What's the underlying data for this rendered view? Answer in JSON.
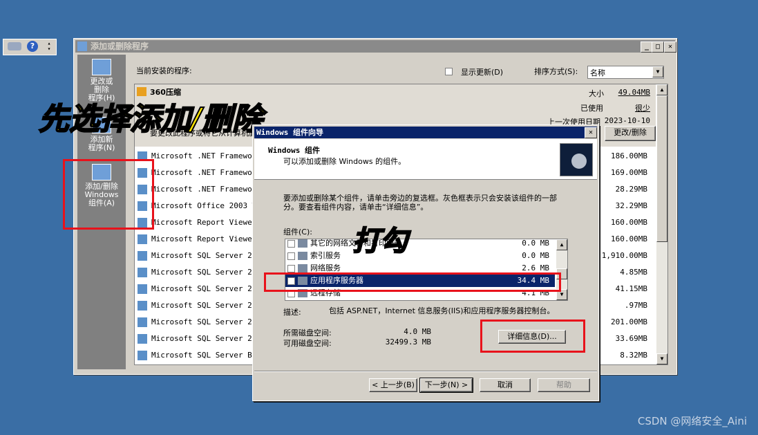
{
  "toolbar": {
    "help_label": "?"
  },
  "window": {
    "title": "添加或删除程序",
    "minimize": "_",
    "maximize": "□",
    "close": "✕",
    "installed_label": "当前安装的程序:",
    "show_updates_label": "显示更新(D)",
    "sort_label": "排序方式(S):",
    "sort_value": "名称"
  },
  "sidebar": {
    "items": [
      {
        "label": "更改或\n删除\n程序(H)"
      },
      {
        "label": "添加新\n程序(N)"
      },
      {
        "label": "添加/删除\nWindows\n组件(A)"
      }
    ]
  },
  "selected_program": {
    "name": "360压缩",
    "desc": "要更改此程序或将它从计算机删除",
    "size_label": "大小",
    "size_value": "49.04MB",
    "used_label": "已使用",
    "used_value": "很少",
    "last_used_label": "上一次使用日期",
    "last_used_value": "2023-10-10",
    "change_remove_button": "更改/删除"
  },
  "programs": [
    {
      "name": "Microsoft .NET Framework",
      "size_label": "小",
      "size": "186.00MB"
    },
    {
      "name": "Microsoft .NET Framework",
      "size_label": "小",
      "size": "169.00MB"
    },
    {
      "name": "Microsoft .NET Framework",
      "size_label": "小",
      "size": "28.29MB"
    },
    {
      "name": "Microsoft Office 2003 Web",
      "size_label": "小",
      "size": "32.29MB"
    },
    {
      "name": "Microsoft Report Viewer R",
      "size_label": "小",
      "size": "160.00MB"
    },
    {
      "name": "Microsoft Report Viewer R",
      "size_label": "小",
      "size": "160.00MB"
    },
    {
      "name": "Microsoft SQL Server 2008",
      "size_label": "小",
      "size": "1,910.00MB"
    },
    {
      "name": "Microsoft SQL Server 2008",
      "size_label": "小",
      "size": "4.85MB"
    },
    {
      "name": "Microsoft SQL Server 2008",
      "size_label": "小",
      "size": "41.15MB"
    },
    {
      "name": "Microsoft SQL Server 2008",
      "size_label": "小",
      "size": ".97MB"
    },
    {
      "name": "Microsoft SQL Server 2008",
      "size_label": "小",
      "size": "201.00MB"
    },
    {
      "name": "Microsoft SQL Server 2008",
      "size_label": "小",
      "size": "33.69MB"
    },
    {
      "name": "Microsoft SQL Server Brow",
      "size_label": "小",
      "size": "8.32MB"
    }
  ],
  "dialog": {
    "title": "Windows 组件向导",
    "close": "✕",
    "heading": "Windows 组件",
    "subheading": "可以添加或删除 Windows 的组件。",
    "instructions": "要添加或删除某个组件，请单击旁边的复选框。灰色框表示只会安装该组件的一部分。要查看组件内容，请单击“详细信息”。",
    "components_label": "组件(C):",
    "components": [
      {
        "name": "其它的网络文件和打印服务",
        "size": "0.0 MB"
      },
      {
        "name": "索引服务",
        "size": "0.0 MB"
      },
      {
        "name": "网络服务",
        "size": "2.6 MB"
      },
      {
        "name": "应用程序服务器",
        "size": "34.4 MB"
      },
      {
        "name": "远程存储",
        "size": "4.1 MB"
      }
    ],
    "desc_label": "描述:",
    "desc_value": "包括 ASP.NET，Internet 信息服务(IIS)和应用程序服务器控制台。",
    "disk_required_label": "所需磁盘空间:",
    "disk_required_value": "4.0 MB",
    "disk_available_label": "可用磁盘空间:",
    "disk_available_value": "32499.3 MB",
    "details_button": "详细信息(D)...",
    "back_button": "< 上一步(B)",
    "next_button": "下一步(N) >",
    "cancel_button": "取消",
    "help_button": "帮助"
  },
  "annotations": {
    "step1": "先选择添加/删除",
    "step2": "打勾"
  },
  "watermark": "CSDN @网络安全_Aini",
  "colors": {
    "highlight_red": "#e8121b",
    "annotation_yellow": "#ffe600",
    "desktop": "#3a6ea5"
  }
}
